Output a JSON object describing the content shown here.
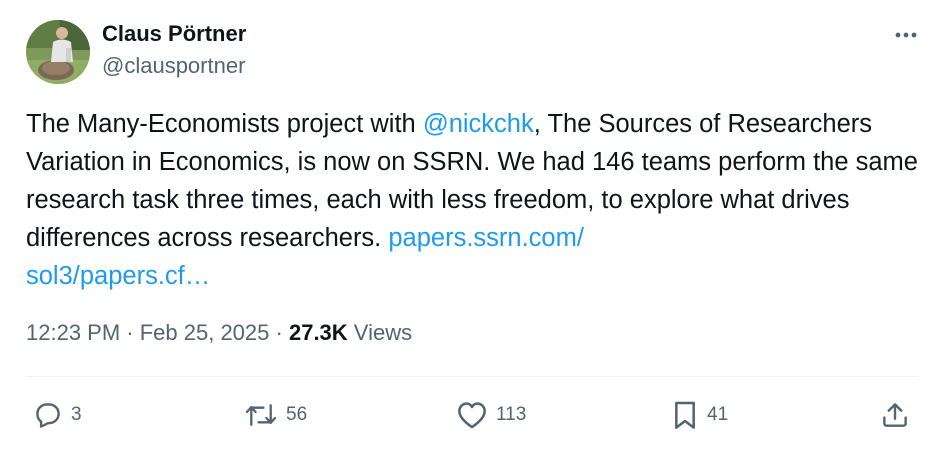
{
  "author": {
    "display_name": "Claus Pörtner",
    "handle": "@clausportner"
  },
  "tweet": {
    "text_part1": "The Many-Economists project with ",
    "mention": "@nickchk",
    "text_part2": ", The Sources of Researchers Variation in Economics, is now on SSRN. We had 146 teams perform the same research task three times, each with less freedom, to explore what drives differences across researchers. ",
    "link_line1": "papers.ssrn.com/",
    "link_line2": "sol3/papers.cf…"
  },
  "meta": {
    "time": "12:23 PM",
    "separator1": " · ",
    "date": "Feb 25, 2025",
    "separator2": " · ",
    "views_count": "27.3K",
    "views_label": " Views"
  },
  "actions": {
    "reply_count": "3",
    "retweet_count": "56",
    "like_count": "113",
    "bookmark_count": "41"
  },
  "icons": {
    "more": "more-icon",
    "reply": "reply-icon",
    "retweet": "retweet-icon",
    "like": "heart-icon",
    "bookmark": "bookmark-icon",
    "share": "share-icon"
  },
  "colors": {
    "link": "#1d9bf0",
    "text": "#0f1419",
    "secondary": "#536471",
    "divider": "#eff3f4"
  }
}
